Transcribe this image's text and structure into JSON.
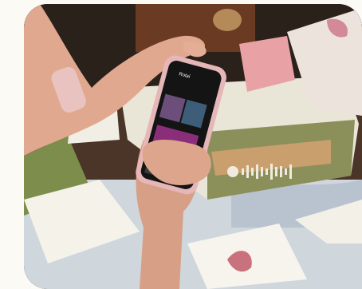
{
  "photo": {
    "app_header_text": "Rotaí",
    "box_logo": "spotify-code-icon"
  }
}
